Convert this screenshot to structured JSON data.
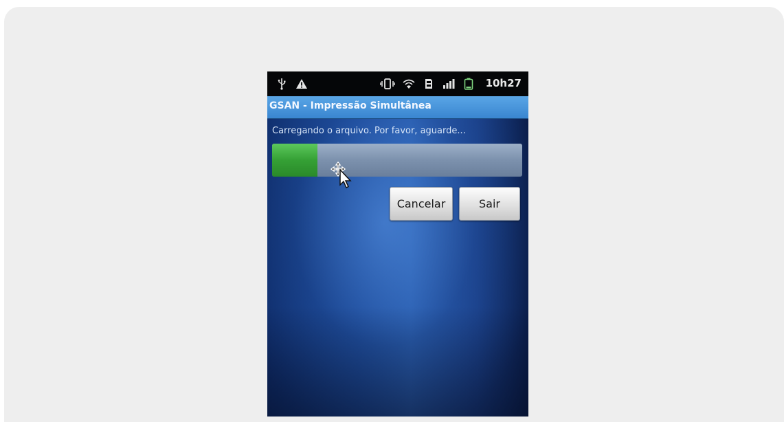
{
  "status_bar": {
    "time": "10h27",
    "icons": [
      "usb-icon",
      "warning-icon",
      "vibrate-icon",
      "wifi-icon",
      "sd-card-icon",
      "signal-icon",
      "battery-icon"
    ]
  },
  "app": {
    "title": "GSAN - Impressão Simultânea"
  },
  "loading": {
    "message": "Carregando o arquivo. Por favor, aguarde...",
    "progress_percent": 18
  },
  "buttons": {
    "cancel_label": "Cancelar",
    "exit_label": "Sair"
  },
  "colors": {
    "title_bar": "#4a96dc",
    "progress_fill": "#35a035",
    "background": "#1c4a9a"
  }
}
